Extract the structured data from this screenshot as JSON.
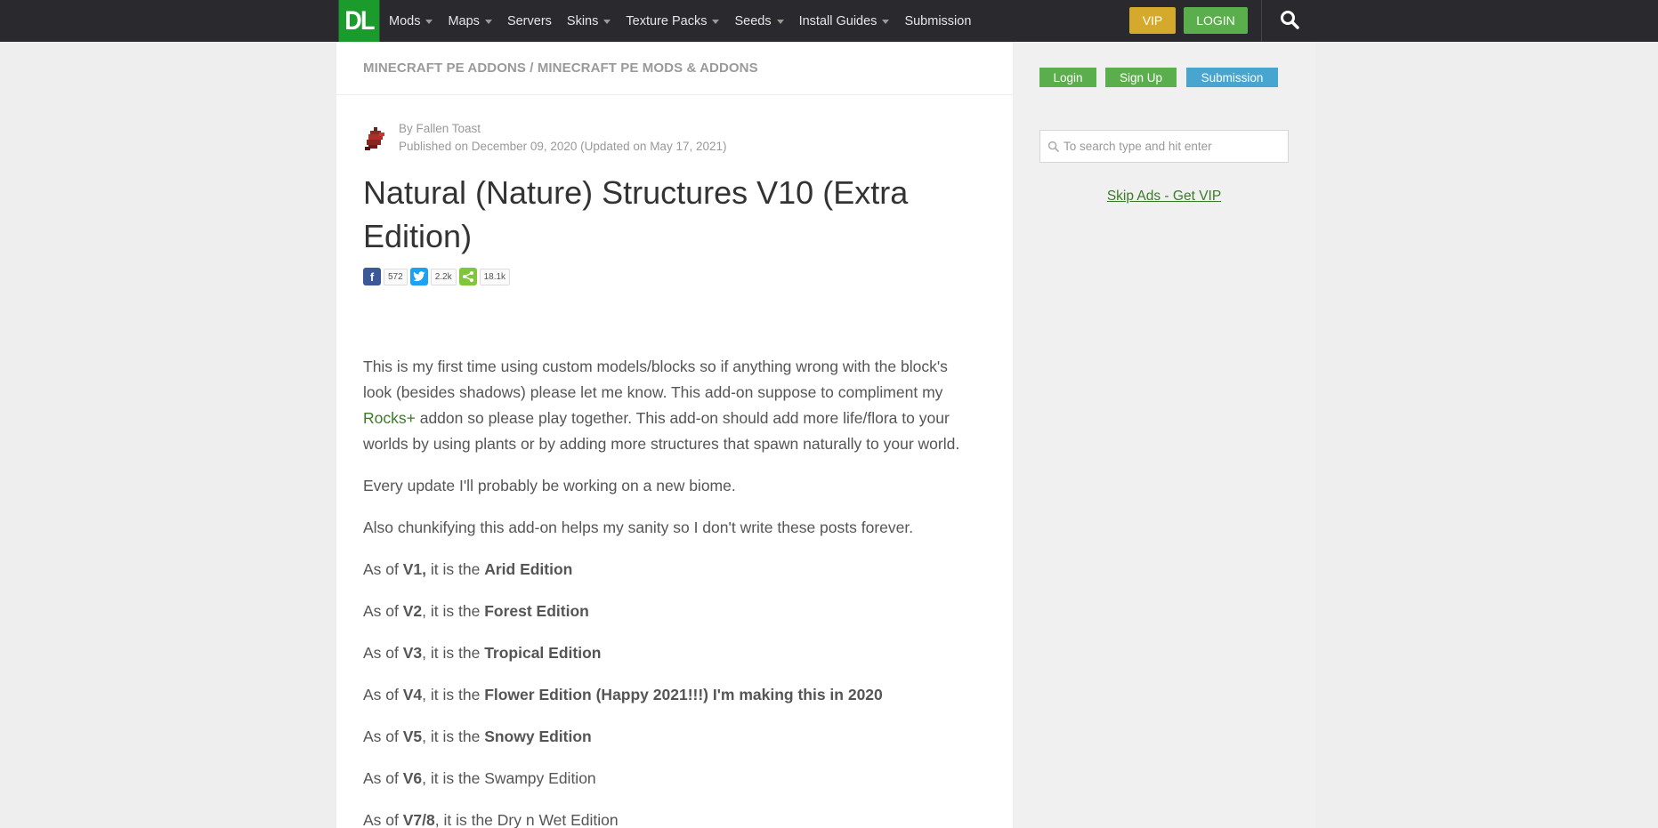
{
  "nav": {
    "logo": "DL",
    "items": [
      {
        "label": "Mods",
        "dropdown": true
      },
      {
        "label": "Maps",
        "dropdown": true
      },
      {
        "label": "Servers",
        "dropdown": false
      },
      {
        "label": "Skins",
        "dropdown": true
      },
      {
        "label": "Texture Packs",
        "dropdown": true
      },
      {
        "label": "Seeds",
        "dropdown": true
      },
      {
        "label": "Install Guides",
        "dropdown": true
      },
      {
        "label": "Submission",
        "dropdown": false
      }
    ],
    "vip_label": "VIP",
    "login_label": "LOGIN"
  },
  "breadcrumb": "MINECRAFT PE ADDONS / MINECRAFT PE MODS & ADDONS",
  "author": {
    "by": "By Fallen Toast",
    "published": "Published on December 09, 2020 (Updated on May 17, 2021)"
  },
  "title": "Natural (Nature) Structures V10 (Extra Edition)",
  "shares": {
    "facebook": "572",
    "twitter": "2.2k",
    "share": "18.1k"
  },
  "content": {
    "p1_before": "This is my first time using custom models/blocks so if anything wrong with the block's look (besides shadows) please let me know. This add-on suppose to compliment my ",
    "p1_link": "Rocks+",
    "p1_after": " addon so please play together. This add-on should add more life/flora to your worlds by using plants or by adding more structures that spawn naturally to your world.",
    "p2": "Every update I'll probably be working on a new biome.",
    "p3": "Also chunkifying this add-on helps my sanity so I don't write these posts forever.",
    "versions": [
      {
        "prefix": "As of ",
        "version": "V1,",
        "mid": " it is the ",
        "edition": "Arid Edition",
        "edition_bold": true
      },
      {
        "prefix": "As of ",
        "version": "V2",
        "mid": ", it is the ",
        "edition": "Forest Edition",
        "edition_bold": true
      },
      {
        "prefix": "As of ",
        "version": "V3",
        "mid": ", it is the ",
        "edition": "Tropical Edition",
        "edition_bold": true
      },
      {
        "prefix": "As of ",
        "version": "V4",
        "mid": ", it is the ",
        "edition": "Flower Edition (Happy 2021!!!) I'm making this in 2020",
        "edition_bold": true
      },
      {
        "prefix": "As of ",
        "version": "V5",
        "mid": ", it is the ",
        "edition": "Snowy Edition",
        "edition_bold": true
      },
      {
        "prefix": "As of ",
        "version": "V6",
        "mid": ", it is the ",
        "edition": "Swampy Edition",
        "edition_bold": false
      },
      {
        "prefix": "As of ",
        "version": "V7/8",
        "mid": ", it is the ",
        "edition": "Dry n Wet Edition",
        "edition_bold": false
      }
    ]
  },
  "sidebar": {
    "login_label": "Login",
    "signup_label": "Sign Up",
    "submission_label": "Submission",
    "search_placeholder": "To search type and hit enter",
    "skip_ads": "Skip Ads - Get VIP"
  },
  "colors": {
    "nav_bg": "#2a2a2e",
    "logo_green": "#1a9b2c",
    "vip_gold": "#d4a92c",
    "login_green": "#5aae4b",
    "submission_blue": "#47a5cf",
    "link_green": "#3b7a28"
  }
}
